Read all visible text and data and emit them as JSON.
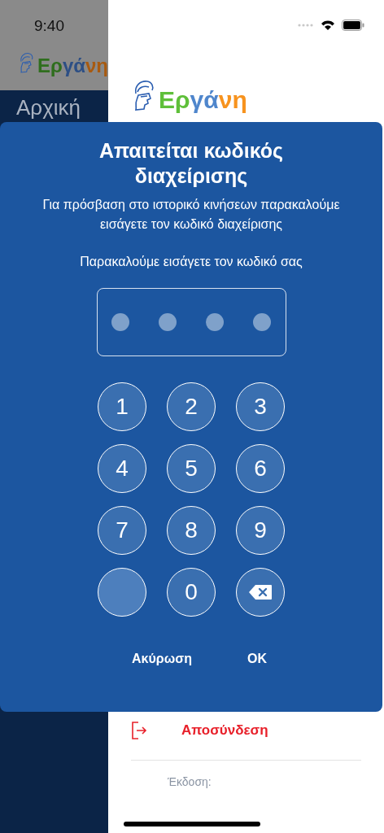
{
  "background_app": {
    "time": "9:40",
    "logo": [
      {
        "text": "Ερ",
        "color": "#2f6e1e"
      },
      {
        "text": "γά",
        "color": "#2d4f85"
      },
      {
        "text": "νη",
        "color": "#a85a10"
      }
    ],
    "menu_item": "Αρχική"
  },
  "sidebar": {
    "logo": [
      {
        "text": "Ερ",
        "color": "#5fbf3a"
      },
      {
        "text": "γά",
        "color": "#4f86cc"
      },
      {
        "text": "νη",
        "color": "#f7931e"
      }
    ],
    "logout": "Αποσύνδεση",
    "version": "Έκδοση:"
  },
  "dialog": {
    "title": "Απαιτείται κωδικός διαχείρισης",
    "message": "Για πρόσβαση στο ιστορικό κινήσεων παρακαλούμε εισάγετε τον κωδικό διαχείρισης",
    "prompt": "Παρακαλούμε εισάγετε τον κωδικό σας",
    "pin": [
      {
        "filled": false
      },
      {
        "filled": false
      },
      {
        "filled": false
      },
      {
        "filled": false
      }
    ],
    "keys": [
      {
        "kind": "digit",
        "label": "1"
      },
      {
        "kind": "digit",
        "label": "2"
      },
      {
        "kind": "digit",
        "label": "3"
      },
      {
        "kind": "digit",
        "label": "4"
      },
      {
        "kind": "digit",
        "label": "5"
      },
      {
        "kind": "digit",
        "label": "6"
      },
      {
        "kind": "digit",
        "label": "7"
      },
      {
        "kind": "digit",
        "label": "8"
      },
      {
        "kind": "digit",
        "label": "9"
      },
      {
        "kind": "blank"
      },
      {
        "kind": "digit",
        "label": "0"
      },
      {
        "kind": "backspace"
      }
    ],
    "buttons": [
      "Ακύρωση",
      "OK"
    ]
  }
}
